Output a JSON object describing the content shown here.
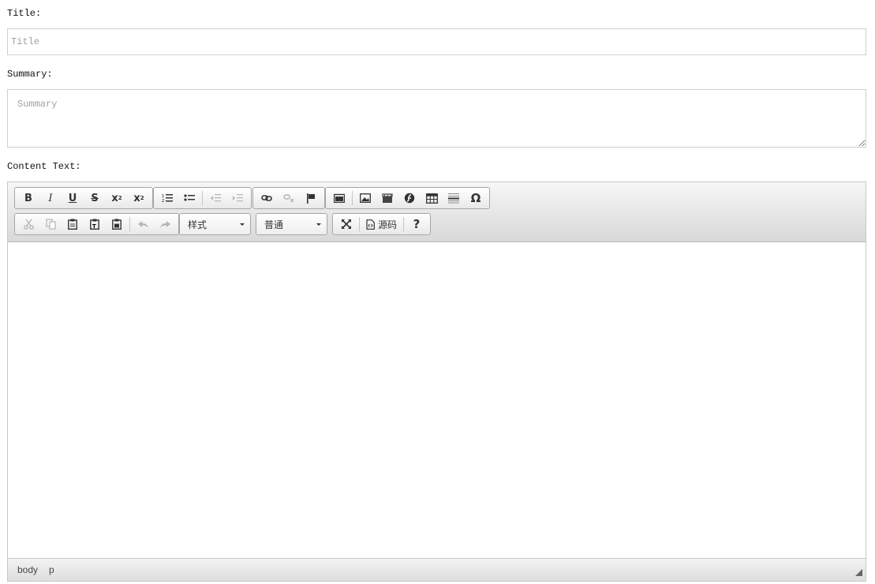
{
  "form": {
    "title_label": "Title:",
    "title_placeholder": "Title",
    "summary_label": "Summary:",
    "summary_placeholder": "Summary",
    "content_label": "Content Text:"
  },
  "toolbar": {
    "bold": "B",
    "italic": "I",
    "underline": "U",
    "strike": "S",
    "subscript": "x",
    "subscript_mark": "2",
    "superscript": "x",
    "superscript_mark": "2",
    "numbered_list_icon": "numbered-list-icon",
    "bulleted_list_icon": "bulleted-list-icon",
    "link_icon": "link-icon",
    "anchor_icon": "flag-icon",
    "special_char": "Ω",
    "styles_combo": "样式",
    "format_combo": "普通",
    "source_label": "源码",
    "help_label": "?"
  },
  "status": {
    "path": [
      "body",
      "p"
    ]
  }
}
